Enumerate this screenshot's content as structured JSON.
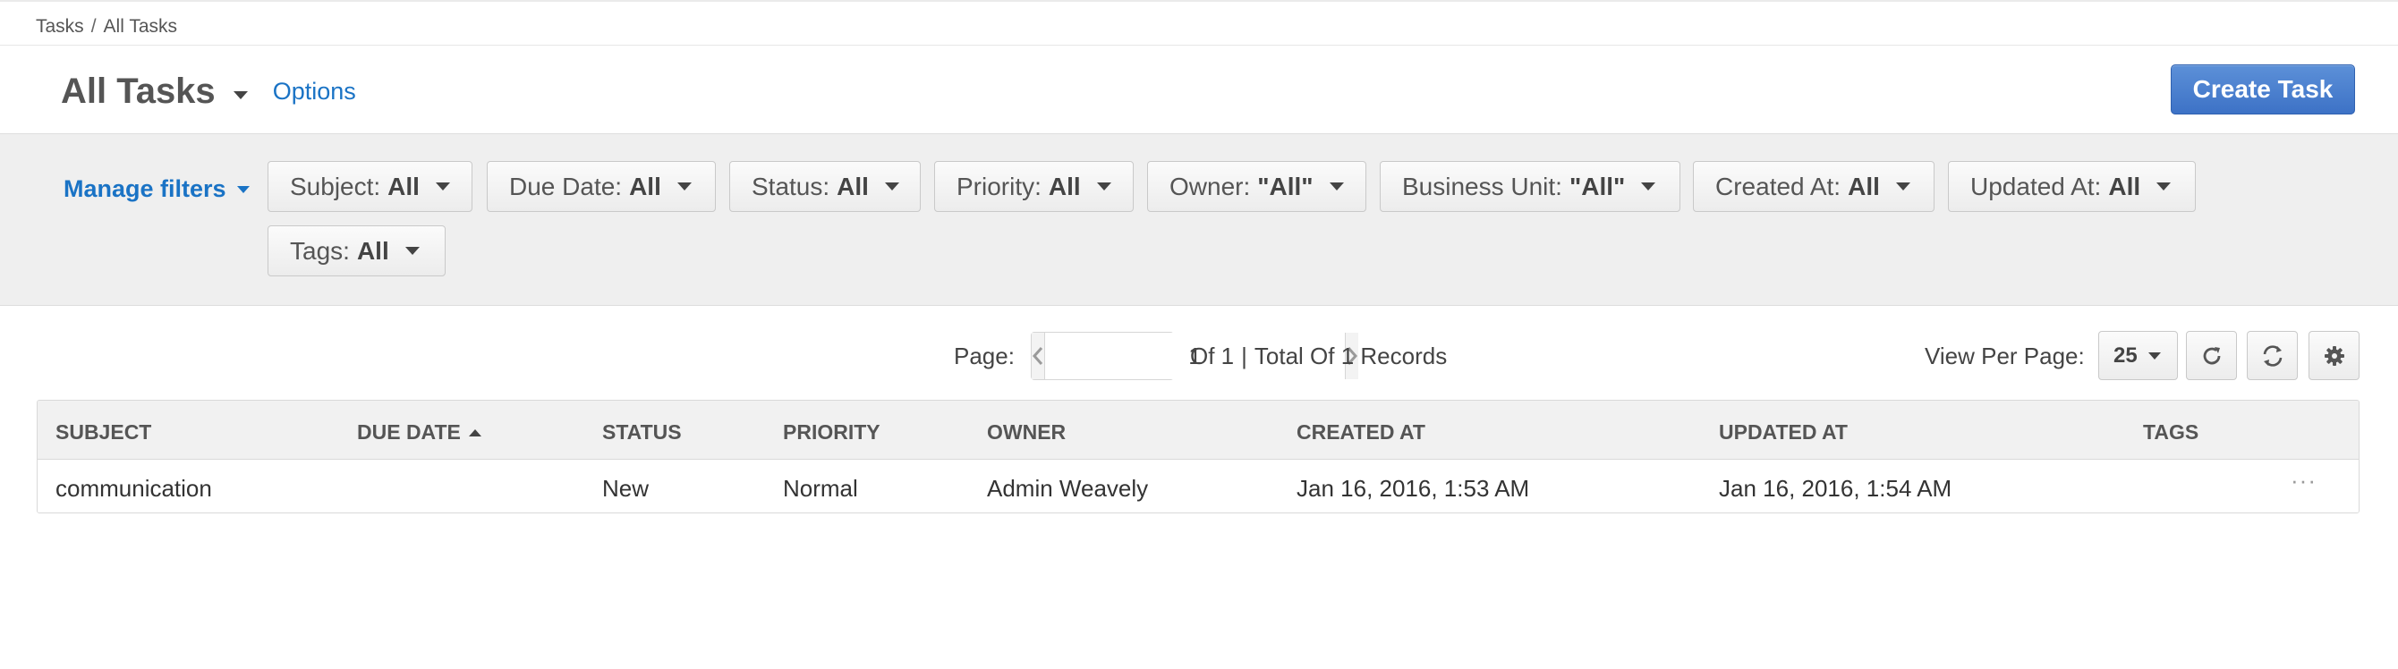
{
  "breadcrumb": {
    "parent": "Tasks",
    "separator": "/",
    "current": "All Tasks"
  },
  "header": {
    "title": "All Tasks",
    "options_label": "Options",
    "create_label": "Create Task"
  },
  "filters": {
    "manage_label": "Manage filters",
    "items": [
      {
        "label": "Subject:",
        "value": "All"
      },
      {
        "label": "Due Date:",
        "value": "All"
      },
      {
        "label": "Status:",
        "value": "All"
      },
      {
        "label": "Priority:",
        "value": "All"
      },
      {
        "label": "Owner:",
        "value": "\"All\""
      },
      {
        "label": "Business Unit:",
        "value": "\"All\""
      },
      {
        "label": "Created At:",
        "value": "All"
      },
      {
        "label": "Updated At:",
        "value": "All"
      },
      {
        "label": "Tags:",
        "value": "All"
      }
    ]
  },
  "pager": {
    "label": "Page:",
    "current": "1",
    "of_text": "Of 1",
    "divider": "|",
    "total_text": "Total Of 1 Records",
    "view_per_page_label": "View Per Page:",
    "view_per_page_value": "25"
  },
  "grid": {
    "columns": [
      "SUBJECT",
      "DUE DATE",
      "STATUS",
      "PRIORITY",
      "OWNER",
      "CREATED AT",
      "UPDATED AT",
      "TAGS"
    ],
    "sorted_column": "DUE DATE",
    "sort_direction": "ascending",
    "rows": [
      {
        "subject": "communication",
        "due_date": "",
        "status": "New",
        "priority": "Normal",
        "owner": "Admin Weavely",
        "created_at": "Jan 16, 2016, 1:53 AM",
        "updated_at": "Jan 16, 2016, 1:54 AM",
        "tags": "",
        "actions": "···"
      }
    ]
  },
  "icons": {
    "refresh": "refresh-icon",
    "reset": "reset-icon",
    "settings": "gear-icon"
  },
  "colors": {
    "link": "#1a73c5",
    "primary_button": "#3d72c6",
    "filter_bar": "#efefef"
  }
}
